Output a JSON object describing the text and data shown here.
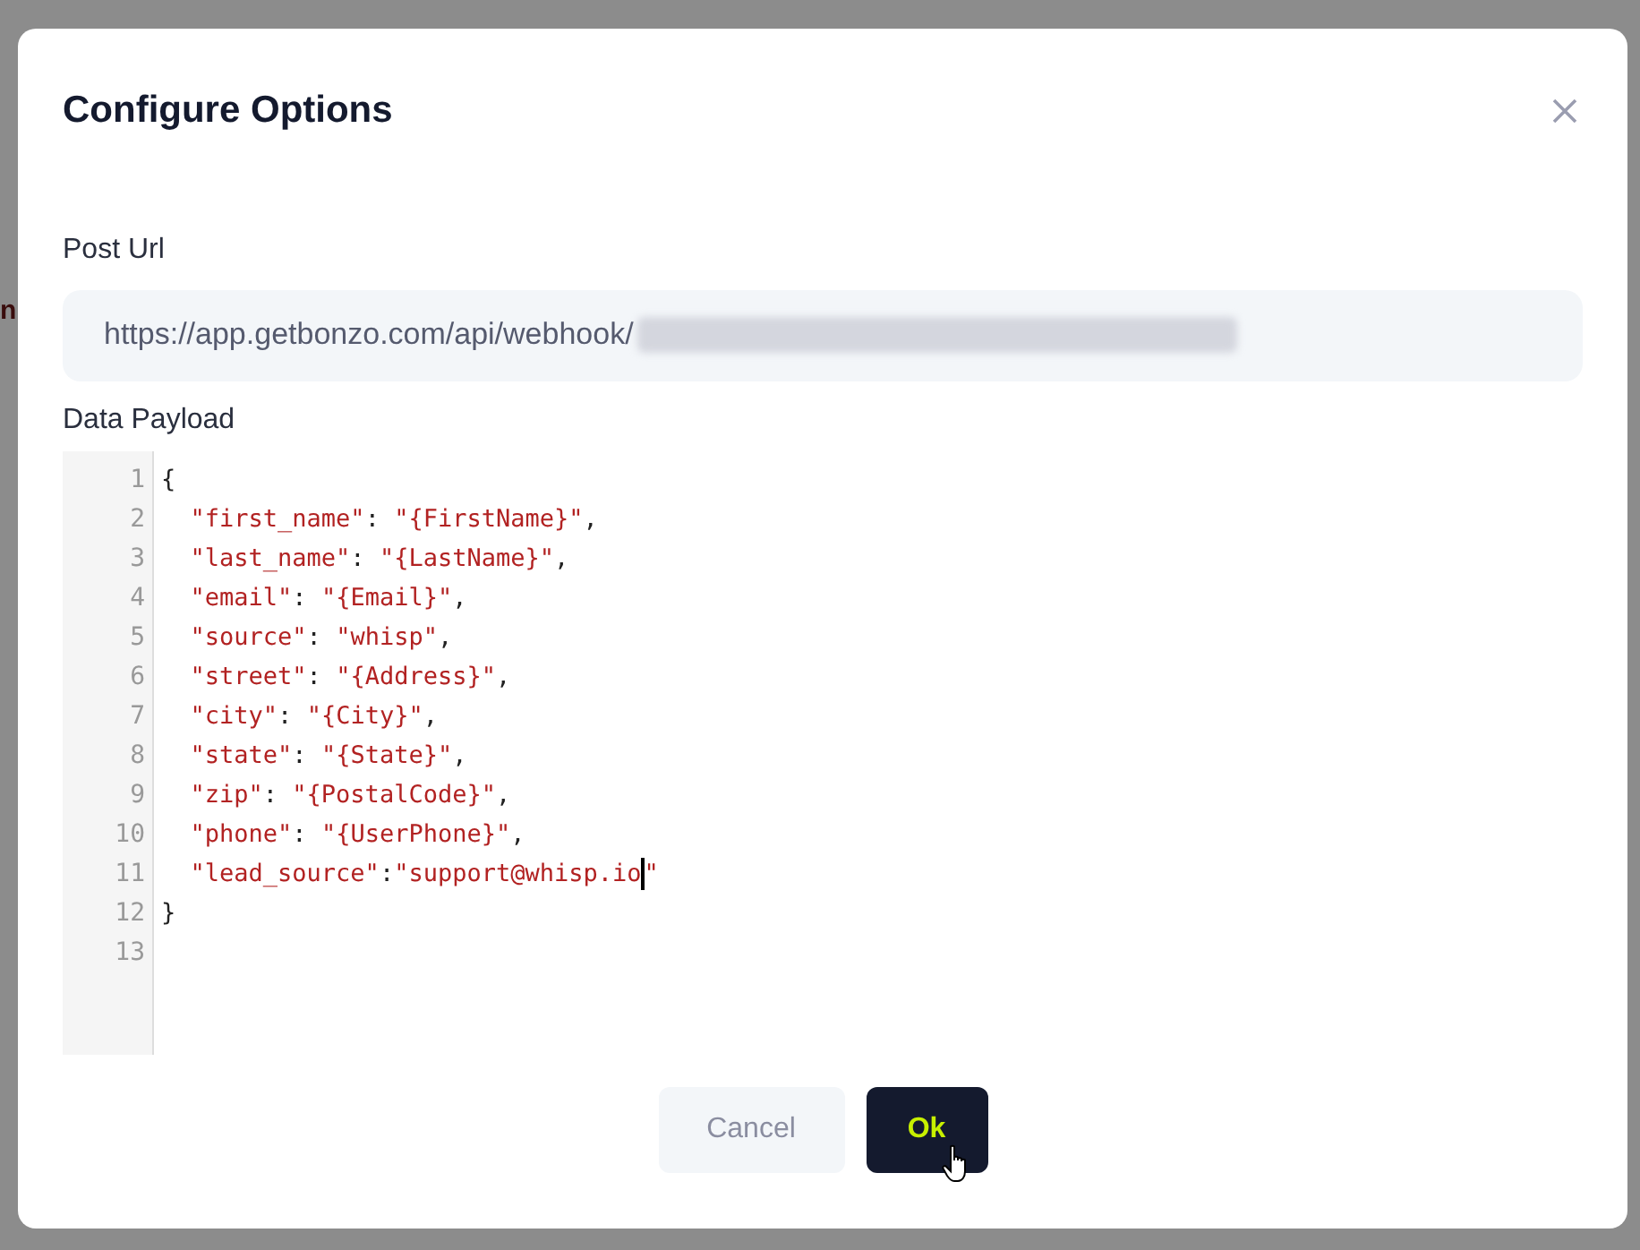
{
  "background": {
    "left_fragments": [
      {
        "text": "n",
        "kind": "title"
      }
    ]
  },
  "dialog": {
    "title": "Configure Options",
    "post_url": {
      "label": "Post Url",
      "value": "https://app.getbonzo.com/api/webhook/",
      "redacted": true
    },
    "data_payload": {
      "label": "Data Payload",
      "lines": [
        {
          "number": "1",
          "text": "{",
          "has_cursor": false
        },
        {
          "number": "2",
          "text": "  \"first_name\": \"{FirstName}\",",
          "has_cursor": false
        },
        {
          "number": "3",
          "text": "  \"last_name\": \"{LastName}\",",
          "has_cursor": false
        },
        {
          "number": "4",
          "text": "  \"email\": \"{Email}\",",
          "has_cursor": false
        },
        {
          "number": "5",
          "text": "  \"source\": \"whisp\",",
          "has_cursor": false
        },
        {
          "number": "6",
          "text": "  \"street\": \"{Address}\",",
          "has_cursor": false
        },
        {
          "number": "7",
          "text": "  \"city\": \"{City}\",",
          "has_cursor": false
        },
        {
          "number": "8",
          "text": "  \"state\": \"{State}\",",
          "has_cursor": false
        },
        {
          "number": "9",
          "text": "  \"zip\": \"{PostalCode}\",",
          "has_cursor": false
        },
        {
          "number": "10",
          "text": "  \"phone\": \"{UserPhone}\",",
          "has_cursor": false
        },
        {
          "number": "11",
          "text": "  \"lead_source\":\"support@whisp.io",
          "after_cursor": "\"",
          "has_cursor": true
        },
        {
          "number": "12",
          "text": "}",
          "has_cursor": false
        },
        {
          "number": "13"
        }
      ]
    },
    "buttons": [
      {
        "label": "Cancel",
        "kind": "secondary"
      },
      {
        "label": "Ok",
        "kind": "primary",
        "hovered": true
      }
    ]
  }
}
